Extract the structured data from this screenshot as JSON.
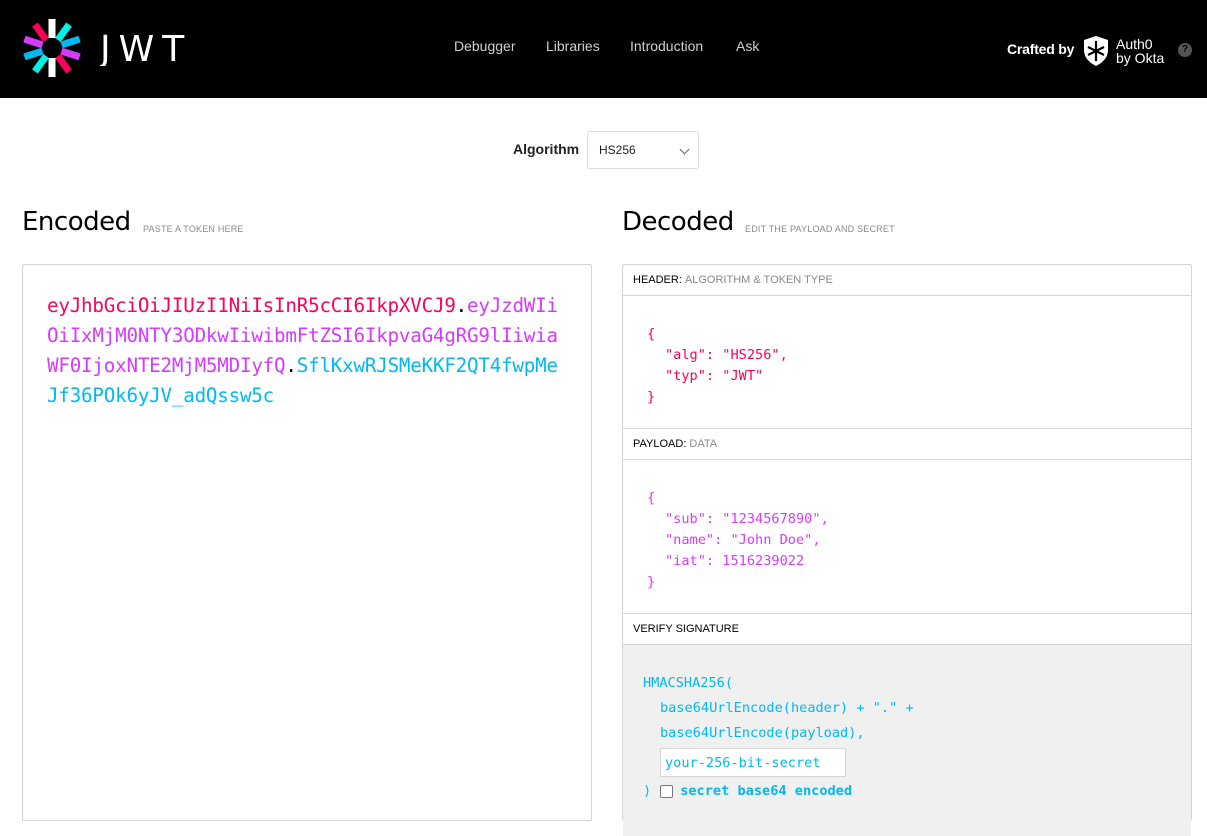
{
  "nav": {
    "items": [
      "Debugger",
      "Libraries",
      "Introduction",
      "Ask"
    ]
  },
  "brand": {
    "logo_text": "JWT",
    "crafted_by": "Crafted by",
    "auth0_line1": "Auth0",
    "auth0_line2": "by Okta",
    "help": "?"
  },
  "algorithm": {
    "label": "Algorithm",
    "selected": "HS256"
  },
  "encoded": {
    "title": "Encoded",
    "subtitle": "PASTE A TOKEN HERE",
    "header_part": "eyJhbGciOiJIUzI1NiIsInR5cCI6IkpXVCJ9",
    "payload_part": "eyJzdWIiOiIxMjM0NTY3ODkwIiwibmFtZSI6IkpvaG4gRG9lIiwiaWF0IjoxNTE2MjM5MDIyfQ",
    "signature_part": "SflKxwRJSMeKKF2QT4fwpMeJf36POk6yJV_adQssw5c",
    "dot": "."
  },
  "decoded": {
    "title": "Decoded",
    "subtitle": "EDIT THE PAYLOAD AND SECRET",
    "header": {
      "label": "HEADER:",
      "sub": "ALGORITHM & TOKEN TYPE",
      "open": "{",
      "line1": "\"alg\": \"HS256\",",
      "line2": "\"typ\": \"JWT\"",
      "close": "}"
    },
    "payload": {
      "label": "PAYLOAD:",
      "sub": "DATA",
      "open": "{",
      "line1": "\"sub\": \"1234567890\",",
      "line2": "\"name\": \"John Doe\",",
      "line3": "\"iat\": 1516239022",
      "close": "}"
    },
    "signature": {
      "label": "VERIFY SIGNATURE",
      "fn": "HMACSHA256(",
      "line1": "base64UrlEncode(header) + \".\" +",
      "line2": "base64UrlEncode(payload),",
      "secret_placeholder": "your-256-bit-secret",
      "close": ")",
      "checkbox_label": "secret base64 encoded"
    }
  },
  "colors": {
    "header": "#fb015b",
    "payload": "#d63aff",
    "signature": "#00b9f1"
  }
}
